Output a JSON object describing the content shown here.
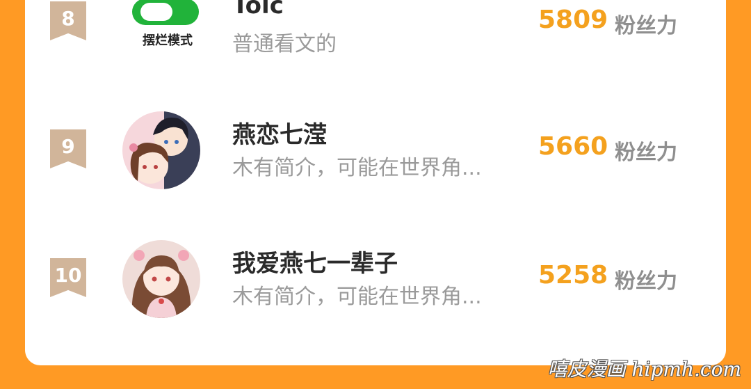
{
  "rows": [
    {
      "rank": "8",
      "name": "Tolc",
      "desc": "普通看文的",
      "score": "5809",
      "unit": "粉丝力",
      "badge_label": "摆烂模式"
    },
    {
      "rank": "9",
      "name": "燕恋七滢",
      "desc": "木有简介，可能在世界角...",
      "score": "5660",
      "unit": "粉丝力"
    },
    {
      "rank": "10",
      "name": "我爱燕七一辈子",
      "desc": "木有简介，可能在世界角...",
      "score": "5258",
      "unit": "粉丝力"
    }
  ],
  "watermark": "嘻皮漫画 hipmh.com",
  "colors": {
    "background": "#FF9A24",
    "card": "#FFFFFF",
    "rank_badge": "#D1B59A",
    "score": "#F4A11E",
    "toggle": "#21B33A"
  },
  "icons": {
    "rank_badge": "ribbon-bookmark-icon",
    "toggle": "toggle-switch-icon"
  }
}
